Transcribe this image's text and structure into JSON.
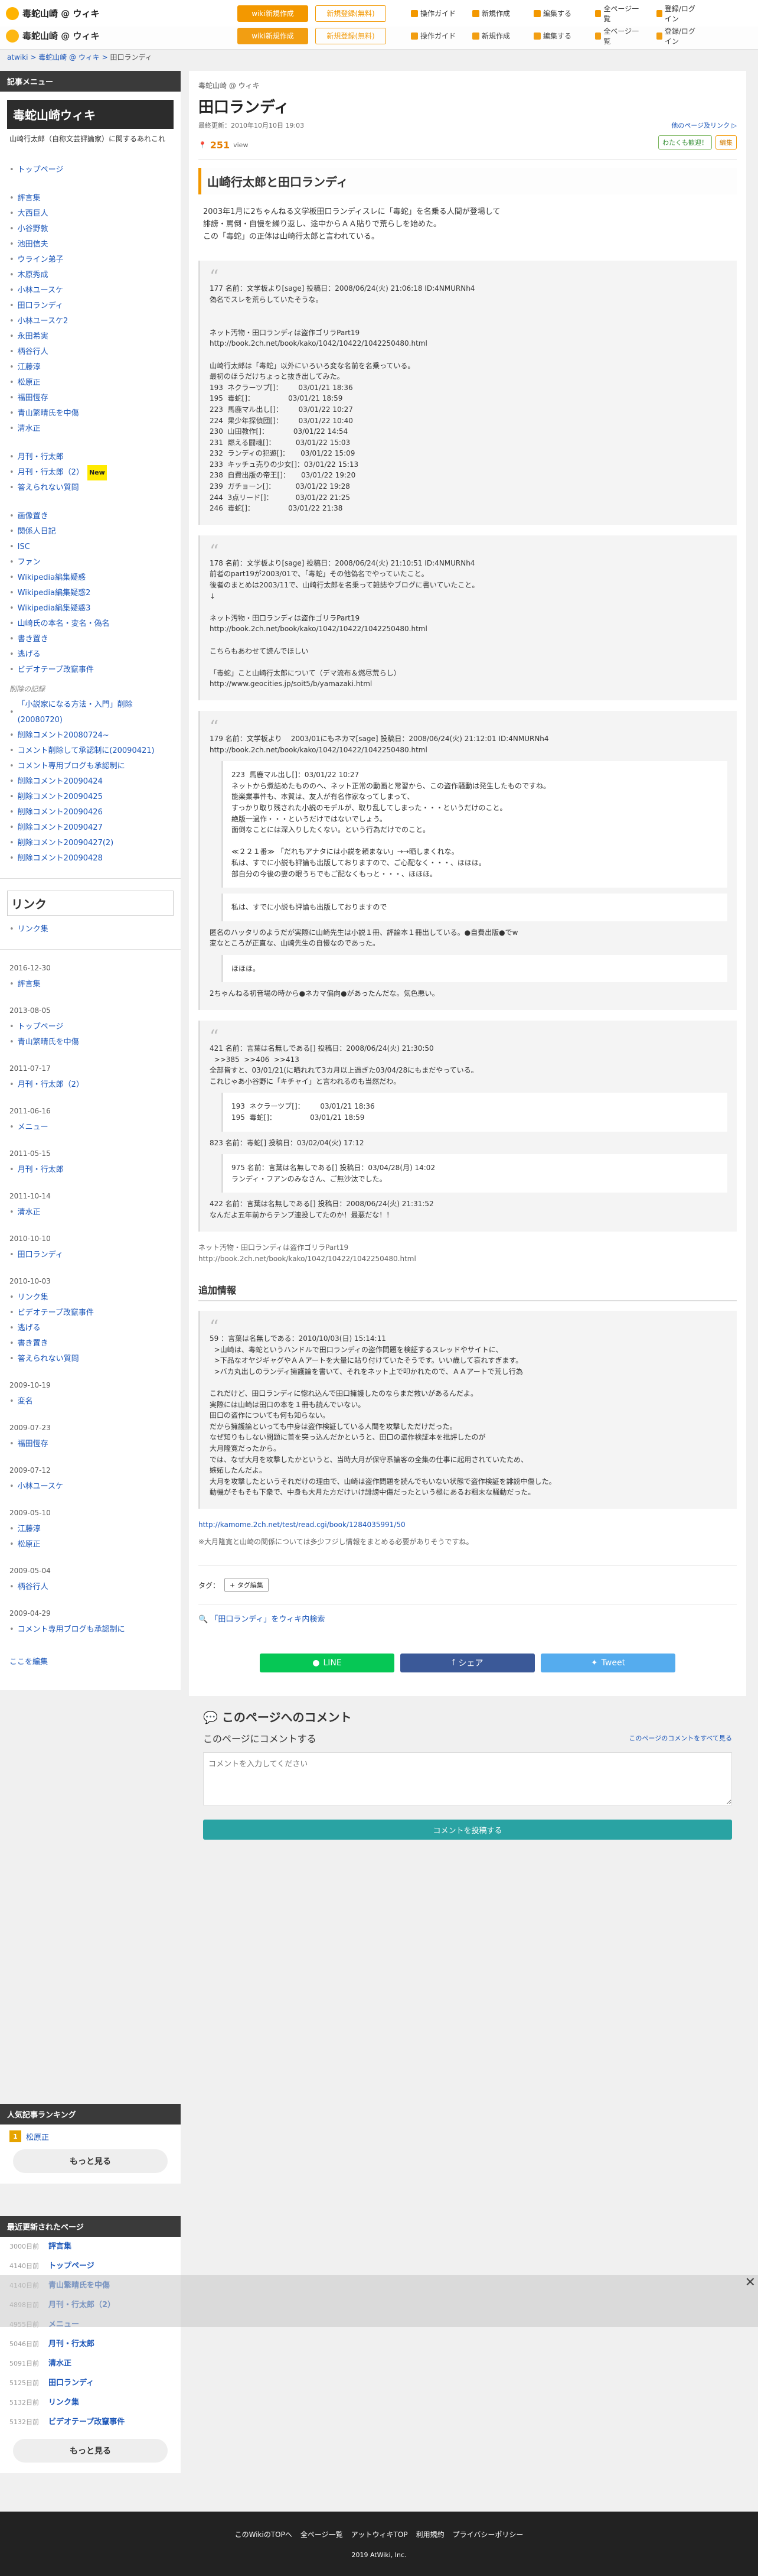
{
  "topbar": {
    "site": "毒蛇山崎 @ ウィキ",
    "btn_wiki": "wiki新規作成",
    "btn_login": "新規登録(無料)",
    "nav": [
      "操作ガイド",
      "新規作成",
      "編集する",
      "全ページ一覧",
      "登録/ログイン"
    ]
  },
  "breadcrumb": {
    "root": "atwiki",
    "wiki": "毒蛇山崎 @ ウィキ",
    "page": "田口ランディ"
  },
  "sidebar": {
    "menu_title": "記事メニュー",
    "wiki_title": "毒蛇山崎ウィキ",
    "wiki_desc": "山崎行太郎（自称文芸評論家）に関するあれこれ",
    "items1": [
      "トップページ"
    ],
    "items2": [
      "評言集",
      "大西巨人",
      "小谷野敦",
      "池田信夫",
      "ウライン弟子",
      "木原秀成",
      "小林ユースケ",
      "田口ランディ",
      "小林ユースケ2",
      "永田希実",
      "柄谷行人",
      "江藤淳",
      "松原正",
      "福田恆存",
      "青山繁晴氏を中傷",
      "清水正"
    ],
    "items3": [
      "月刊・行太郎",
      "月刊・行太郎（2）",
      "答えられない質問"
    ],
    "new_label": "New",
    "items4": [
      "画像置き",
      "関係人日記",
      "ISC",
      "ファン",
      "Wikipedia編集疑惑",
      "Wikipedia編集疑惑2",
      "Wikipedia編集疑惑3",
      "山崎氏の本名・変名・偽名",
      "書き置き",
      "逃げる",
      "ビデオテープ改竄事件"
    ],
    "deleted_note": "削除の記録",
    "items5": [
      "「小説家になる方法・入門」削除(20080720)",
      "削除コメント20080724~",
      "コメント削除して承認制に(20090421)",
      "コメント専用ブログも承認制に",
      "削除コメント20090424",
      "削除コメント20090425",
      "削除コメント20090426",
      "削除コメント20090427",
      "削除コメント20090427(2)",
      "削除コメント20090428"
    ],
    "link_title": "リンク",
    "link_items": [
      "リンク集"
    ],
    "history": [
      {
        "date": "2016-12-30",
        "items": [
          "評言集"
        ]
      },
      {
        "date": "2013-08-05",
        "items": [
          "トップページ",
          "青山繁晴氏を中傷"
        ]
      },
      {
        "date": "2011-07-17",
        "items": [
          "月刊・行太郎（2）"
        ]
      },
      {
        "date": "2011-06-16",
        "items": [
          "メニュー"
        ]
      },
      {
        "date": "2011-05-15",
        "items": [
          "月刊・行太郎"
        ]
      },
      {
        "date": "2011-10-14",
        "items": [
          "清水正"
        ]
      },
      {
        "date": "2010-10-10",
        "items": [
          "田口ランディ"
        ]
      },
      {
        "date": "2010-10-03",
        "items": [
          "リンク集",
          "ビデオテープ改竄事件",
          "逃げる",
          "書き置き",
          "答えられない質問"
        ]
      },
      {
        "date": "2009-10-19",
        "items": [
          "変名"
        ]
      },
      {
        "date": "2009-07-23",
        "items": [
          "福田恆存"
        ]
      },
      {
        "date": "2009-07-12",
        "items": [
          "小林ユースケ"
        ]
      },
      {
        "date": "2009-05-10",
        "items": [
          "江藤淳",
          "松原正"
        ]
      },
      {
        "date": "2009-05-04",
        "items": [
          "柄谷行人"
        ]
      },
      {
        "date": "2009-04-29",
        "items": [
          "コメント専用ブログも承認制に"
        ]
      }
    ],
    "edit_link": "ここを編集"
  },
  "ranking": {
    "title": "人気記事ランキング",
    "items": [
      {
        "rank": "1",
        "label": "松原正"
      }
    ],
    "more": "もっと見る"
  },
  "recent": {
    "title": "最近更新されたページ",
    "items": [
      {
        "d": "3000日前",
        "label": "評言集"
      },
      {
        "d": "4140日前",
        "label": "トップページ"
      },
      {
        "d": "4140日前",
        "label": "青山繁晴氏を中傷"
      },
      {
        "d": "4898日前",
        "label": "月刊・行太郎（2）"
      },
      {
        "d": "4955日前",
        "label": "メニュー"
      },
      {
        "d": "5046日前",
        "label": "月刊・行太郎"
      },
      {
        "d": "5091日前",
        "label": "清水正"
      },
      {
        "d": "5125日前",
        "label": "田口ランディ"
      },
      {
        "d": "5132日前",
        "label": "リンク集"
      },
      {
        "d": "5132日前",
        "label": "ビデオテープ改竄事件"
      }
    ],
    "more": "もっと見る"
  },
  "page": {
    "crumb": "毒蛇山崎 @ ウィキ",
    "title": "田口ランディ",
    "updated": "最終更新：2010年10月10日 19:03",
    "right_meta": "他のページ及リンク ▷",
    "views": "251",
    "views_unit": "view",
    "btn_wiki": "わたくも歓迎！",
    "btn_edit": "編集",
    "h2": "山崎行太郎と田口ランディ",
    "intro": "2003年1月に2ちゃんねる文学板田口ランディスレに「毒蛇」を名乗る人間が登場して\n誹謗・罵倒・自慢を繰り返し、途中からＡＡ貼りで荒らしを始めた。\nこの「毒蛇」の正体は山崎行太郎と言われている。",
    "q1": "177 名前：文学板より[sage] 投稿日：2008/06/24(火) 21:06:18 ID:4NMURNh4\n偽名でスレを荒らしていたそうな。\n\n\nネット汚物・田口ランディは盗作ゴリラPart19\nhttp://book.2ch.net/book/kako/1042/10422/1042250480.html\n\n山崎行太郎は「毒蛇」以外にいろいろ変な名前を名乗っている。\n最初のほうだけちょっと抜き出してみた。\n193  ネクラーツブ[]：       03/01/21 18:36\n195  毒蛇[]：               03/01/21 18:59\n223  馬鹿マル出し[]：       03/01/22 10:27\n224  果少年探偵団[]：       03/01/22 10:40\n230  山田教作[]：           03/01/22 14:54\n231  燃える闘魂[]：         03/01/22 15:03\n232  ランディの犯遊[]：     03/01/22 15:09\n233  キッチュ売りの少女[]：03/01/22 15:13\n238  自費出版の帝王[]：     03/01/22 19:20\n239  ガチョーン[]：         03/01/22 19:28\n244  3点リード[]：          03/01/22 21:25\n246  毒蛇[]：               03/01/22 21:38",
    "q2": "178 名前：文学板より[sage] 投稿日：2008/06/24(火) 21:10:51 ID:4NMURNh4\n前者のpart19が2003/01で、「毒蛇」その他偽名でやっていたこと。\n後者のまとめは2003/11で、山崎行太郎を名乗って雑誌やブログに書いていたこと。\n↓\n\nネット汚物・田口ランディは盗作ゴリラPart19\nhttp://book.2ch.net/book/kako/1042/10422/1042250480.html\n\nこちらもあわせて読んでほしい\n\n「毒蛇」こと山崎行太郎について（デマ流布＆燃尽荒らし）\nhttp://www.geocities.jp/soit5/b/yamazaki.html",
    "q3_head": "179 名前：文学板より    2003/01にもネカマ[sage] 投稿日：2008/06/24(火) 21:12:01 ID:4NMURNh4\nhttp://book.2ch.net/book/kako/1042/10422/1042250480.html",
    "q3_inner1": "223  馬鹿マル出し[]：03/01/22 10:27\nネットから煮詰めたもののへ、ネット正常の動画と常習から、この盗作騒動は発生したものですね。\n能楽業事件も、本質は、友人が有名作家なってしまって、\nすっかり取り残された小説のモデルが、取り乱してしまった・・・というだけのこと。\n絶版一過作・・・というだけではないでしょう。\n面倒なことには深入りしたくない。という行為だけでのこと。\n\n≪２２１番≫ 「だれもアナタには小説を頼まない」→→晒しまくれな。\n私は、すでに小説も評論も出版しておりますので、ご心配なく・・・、ほほほ。\n部自分の今後の妻の眼うちでもご配なくもっと・・・、ほほほ。",
    "q3_inner2": "私は、すでに小説も評論も出版しておりますので",
    "q3_tail": "匿名のハッタリのようだが実際に山崎先生は小説１冊、評論本１冊出している。●自費出版●でw\n変なところが正直な、山崎先生の自慢なのであった。",
    "q3_inner3": "ほほほ。",
    "q3_after": "2ちゃんねる初音場の時から●ネカマ偏向●があったんだな。気色悪い。",
    "q4_head": "421 名前：言葉は名無しである[] 投稿日：2008/06/24(火) 21:30:50\n  >>385  >>406  >>413\n全部皆すと、03/01/21(に晒れれて3カ月以上過ぎた03/04/28にもまだやっている。\nこれじゃあ小谷野に「キチャイ」と言われるのも当然だわ。",
    "q4_inner1": "193  ネクラーツブ[]：       03/01/21 18:36\n195  毒蛇[]：               03/01/21 18:59",
    "q4_mid": "823 名前：毒蛇[] 投稿日：03/02/04(火) 17:12",
    "q4_inner2": "975 名前：言葉は名無しである[] 投稿日：03/04/28(月) 14:02\nランディ・フアンのみなさん、ご無沙汰でした。",
    "q4_tail": "422 名前：言葉は名無しである[] 投稿日：2008/06/24(火) 21:31:52\nなんだよ五年前からテンプ連投してたのか！最悪だな！！",
    "after_quotes": "ネット汚物・田口ランディは盗作ゴリラPart19\nhttp://book.2ch.net/book/kako/1042/10422/1042250480.html",
    "h3": "追加情報",
    "q5": "59 ：言葉は名無しである：2010/10/03(日) 15:14:11\n  >山崎は、毒蛇というハンドルで田口ランディの盗作問題を検証するスレッドやサイトに、\n  >下品なオヤジギャグやＡＡアートを大量に貼り付けていたそうです。いい歳して哀れすぎます。\n  >バカ丸出しのランディ擁護論を書いて、それをネット上で叩かれたので、ＡＡアートで荒し行為\n\nこれだけど、田口ランディに惚れ込んで田口擁護したのならまだ救いがあるんだよ。\n実際には山崎は田口の本を１冊も読んでいない。\n田口の盗作についても何も知らない。\nだから擁護論といっても中身は盗作検証している人間を攻撃しただけだった。\nなぜ知りもしない問題に首を突っ込んだかというと、田口の盗作検証本を批評したのが\n大月隆寛だったから。\nでは、なぜ大月を攻撃したかというと、当時大月が保守系論客の全集の仕事に起用されていたため、\n嫉妬したんだよ。\n大月を攻撃したというそれだけの理由で、山崎は盗作問題を読んでもいない状態で盗作検証を誹謗中傷した。\n動機がそもそも下衆で、中身も大月た方だけいけ誹謗中傷だったという極にあるお粗末な騒動だった。",
    "q5_link": "http://kamome.2ch.net/test/read.cgi/book/1284035991/50",
    "note": "※大月隆寛と山崎の関係については多少フジし情報をまとめる必要がありそうですね。",
    "tags_label": "タグ：",
    "tag_edit": "+ タグ編集",
    "search_wiki": "「田口ランディ」をウィキ内検索",
    "share": {
      "line": "LINE",
      "fb": "シェア",
      "tw": "Tweet"
    },
    "comment": {
      "title": "このページへのコメント",
      "sub": "このページにコメントする",
      "all_link": "このページのコメントをすべて見る",
      "placeholder": "コメントを入力してください",
      "submit": "コメントを投稿する"
    }
  },
  "footer": {
    "links": [
      "このWikiのTOPへ",
      "全ページ一覧",
      "アットウィキTOP",
      "利用規約",
      "プライバシーポリシー"
    ],
    "copy": "2019 AtWiki, Inc."
  }
}
